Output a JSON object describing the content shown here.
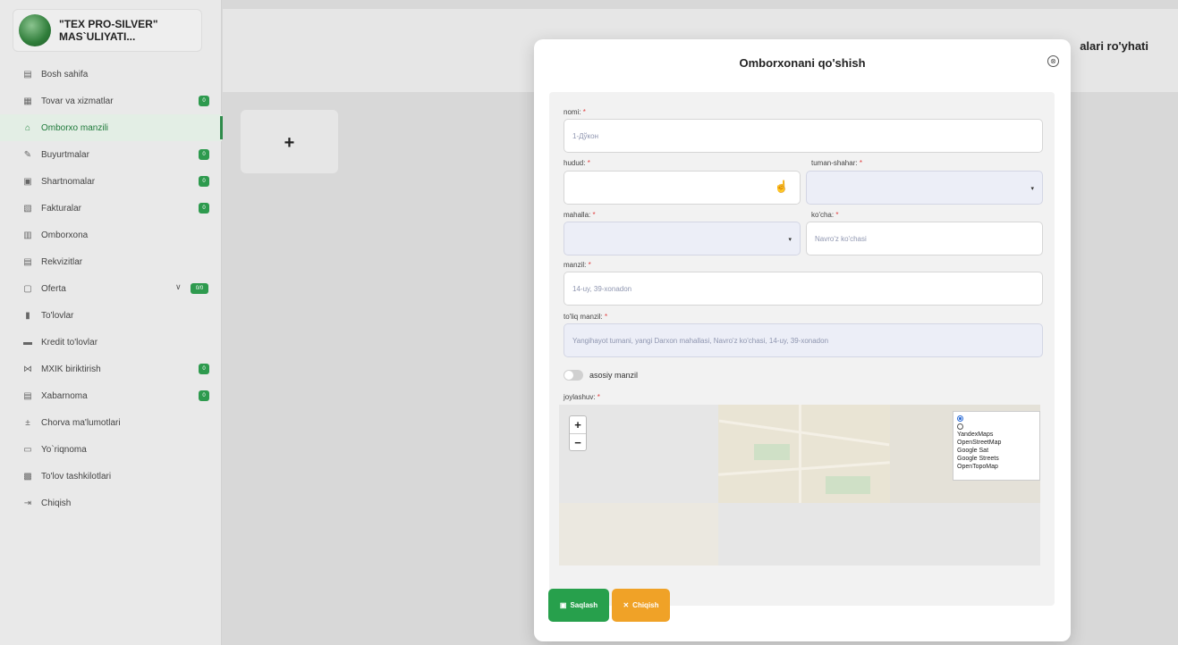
{
  "company": {
    "name_line1": "\"TEX PRO-SILVER\"",
    "name_line2": "MAS`ULIYATI..."
  },
  "sidebar": {
    "items": [
      {
        "label": "Bosh sahifa",
        "icon": "home-icon"
      },
      {
        "label": "Tovar va xizmatlar",
        "icon": "boxes-icon",
        "badge": "0"
      },
      {
        "label": "Omborxo manzili",
        "icon": "warehouse-location-icon",
        "active": true
      },
      {
        "label": "Buyurtmalar",
        "icon": "order-icon",
        "badge": "0"
      },
      {
        "label": "Shartnomalar",
        "icon": "contract-icon",
        "badge": "0"
      },
      {
        "label": "Fakturalar",
        "icon": "invoice-icon",
        "badge": "0"
      },
      {
        "label": "Omborxona",
        "icon": "warehouse-icon"
      },
      {
        "label": "Rekvizitlar",
        "icon": "details-icon"
      },
      {
        "label": "Oferta",
        "icon": "offer-icon",
        "badge": "0/0"
      },
      {
        "label": "To'lovlar",
        "icon": "payment-icon"
      },
      {
        "label": "Kredit to'lovlar",
        "icon": "credit-icon"
      },
      {
        "label": "MXIK biriktirish",
        "icon": "link-icon",
        "badge": "0"
      },
      {
        "label": "Xabarnoma",
        "icon": "message-icon",
        "badge": "0"
      },
      {
        "label": "Chorva ma'lumotlari",
        "icon": "livestock-icon"
      },
      {
        "label": "Yo`riqnoma",
        "icon": "guide-icon"
      },
      {
        "label": "To'lov tashkilotlari",
        "icon": "organization-icon"
      },
      {
        "label": "Chiqish",
        "icon": "logout-icon"
      }
    ]
  },
  "header": {
    "title": "alari ro'yhati"
  },
  "add_card": {
    "label": "+"
  },
  "modal": {
    "title": "Omborxonani qo'shish",
    "close": "⊗",
    "fields": {
      "nomi": {
        "label": "nomi: ",
        "placeholder": "1-Дўкон"
      },
      "hudud": {
        "label": "hudud: ",
        "value": ""
      },
      "tuman": {
        "label": "tuman-shahar: ",
        "value": ""
      },
      "mahalla": {
        "label": "mahalla: ",
        "value": ""
      },
      "kocha": {
        "label": "ko'cha: ",
        "placeholder": "Navro'z ko'chasi"
      },
      "manzil": {
        "label": "manzil: ",
        "placeholder": "14-uy, 39-xonadon"
      },
      "toliq": {
        "label": "to'liq manzil: ",
        "placeholder": "Yangihayot tumani, yangi Darxon mahallasi, Navro'z ko'chasi, 14-uy, 39-xonadon"
      }
    },
    "required_mark": "*",
    "toggle_label": "asosiy manzil",
    "map_label": "joylashuv: ",
    "map": {
      "zoom_in": "+",
      "zoom_out": "−",
      "layers": [
        "YandexMaps",
        "OpenStreetMap",
        "Google Sat",
        "Google Streets",
        "OpenTopoMap"
      ],
      "selected_layer": 0
    },
    "buttons": {
      "save": "Saqlash",
      "exit": "Chiqish"
    }
  },
  "colors": {
    "accent_green": "#27a04c",
    "accent_orange": "#f0a227"
  }
}
